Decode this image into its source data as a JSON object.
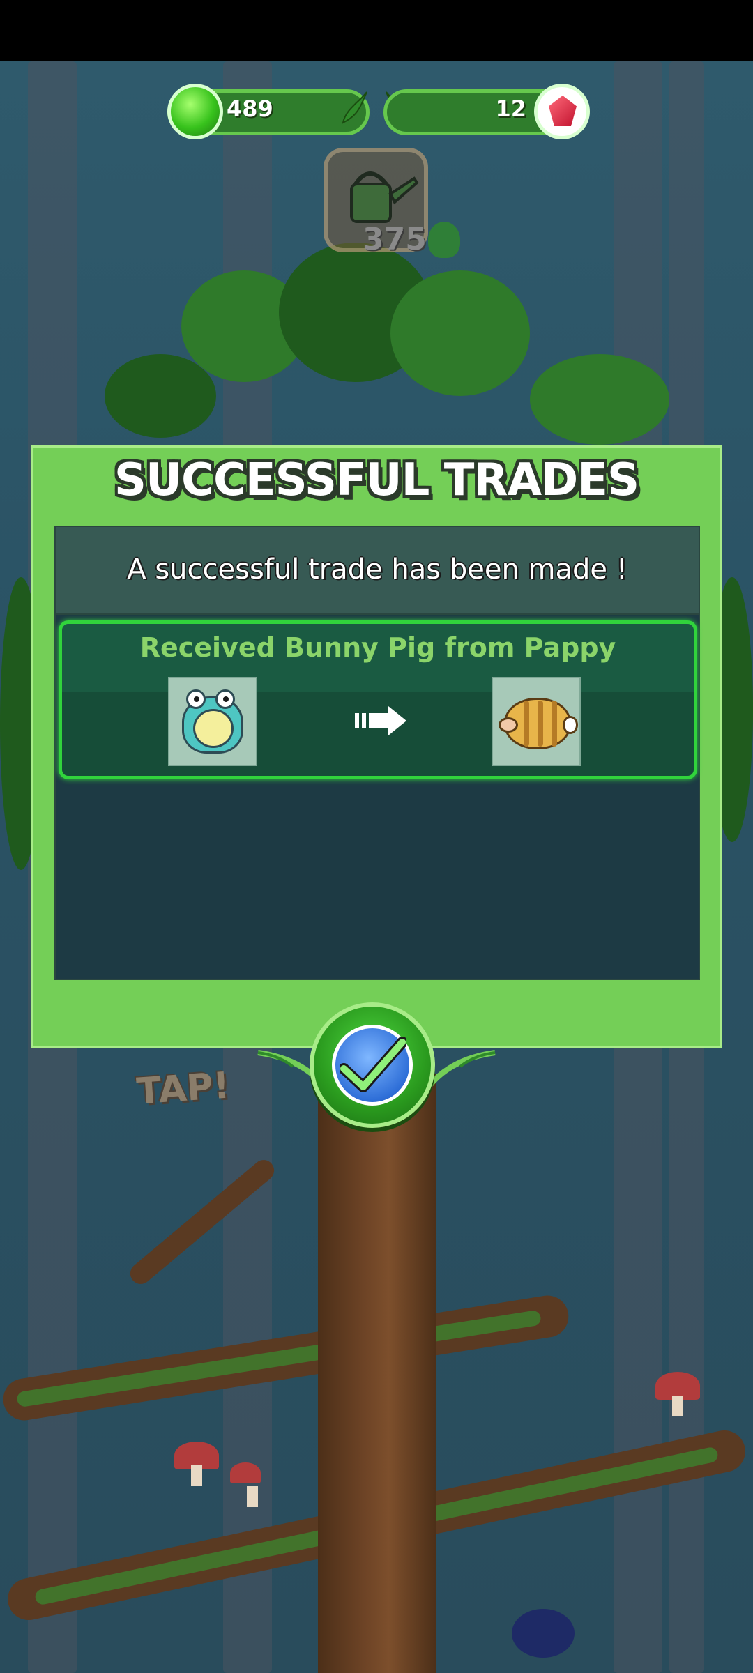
{
  "hud": {
    "green_currency": "489",
    "red_currency": "12"
  },
  "watering_can": {
    "cost": "375"
  },
  "modal": {
    "title": "SUCCESSFUL TRADES",
    "message": "A successful trade has been made !",
    "trades": [
      {
        "label": "Received Bunny Pig from Pappy",
        "given_icon": "frog-creature-icon",
        "received_icon": "bunny-pig-creature-icon"
      }
    ],
    "confirm_icon": "checkmark-icon"
  },
  "scene": {
    "tap_hint": "TAP!"
  },
  "colors": {
    "modal_green": "#74cf57",
    "panel_dark": "#1d3a44",
    "trade_row": "#1a5b42",
    "trade_border": "#31d33c",
    "trade_text": "#8bd46a"
  }
}
